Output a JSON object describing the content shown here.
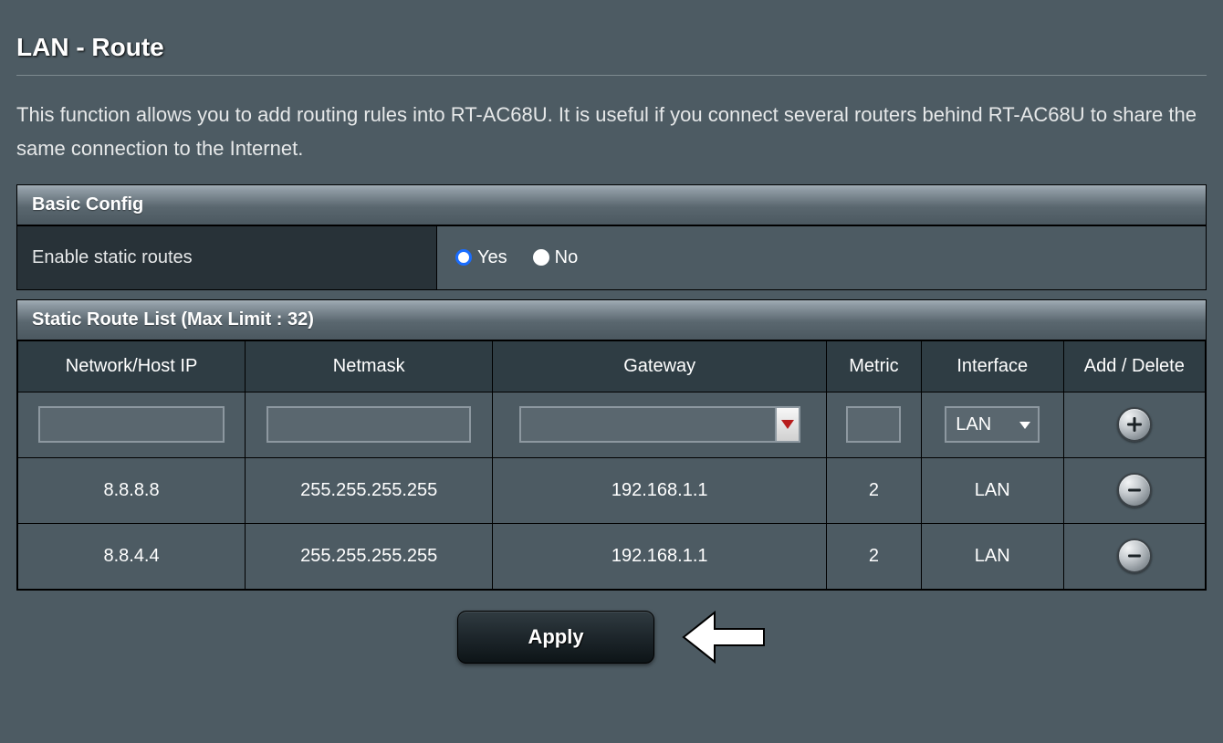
{
  "page_title": "LAN - Route",
  "description": "This function allows you to add routing rules into RT-AC68U. It is useful if you connect several routers behind RT-AC68U to share the same connection to the Internet.",
  "basic_config": {
    "header": "Basic Config",
    "enable_static_routes_label": "Enable static routes",
    "yes_label": "Yes",
    "no_label": "No",
    "selected": "yes"
  },
  "route_list": {
    "header": "Static Route List (Max Limit : 32)",
    "columns": {
      "ip": "Network/Host IP",
      "mask": "Netmask",
      "gateway": "Gateway",
      "metric": "Metric",
      "iface": "Interface",
      "action": "Add / Delete"
    },
    "new_row": {
      "ip": "",
      "mask": "",
      "gateway": "",
      "metric": "",
      "iface_selected": "LAN"
    },
    "rows": [
      {
        "ip": "8.8.8.8",
        "mask": "255.255.255.255",
        "gateway": "192.168.1.1",
        "metric": "2",
        "iface": "LAN"
      },
      {
        "ip": "8.8.4.4",
        "mask": "255.255.255.255",
        "gateway": "192.168.1.1",
        "metric": "2",
        "iface": "LAN"
      }
    ]
  },
  "apply_label": "Apply"
}
